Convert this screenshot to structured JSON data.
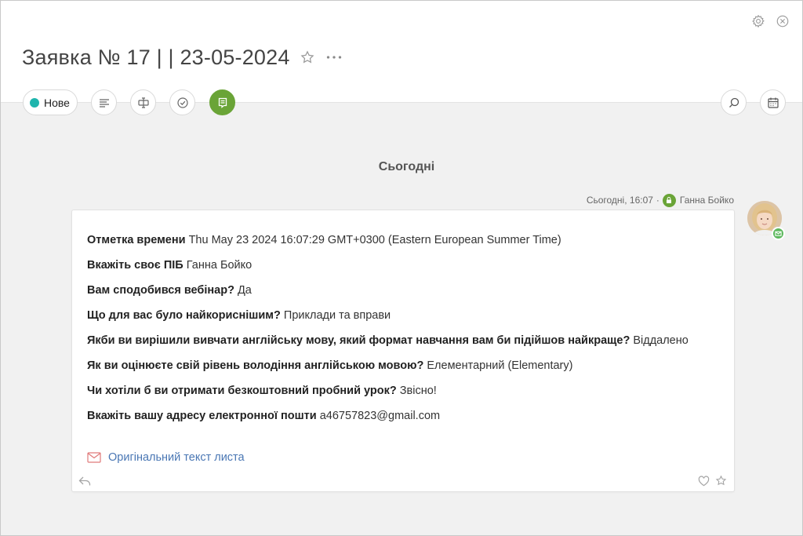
{
  "header": {
    "title": "Заявка № 17 | | 23-05-2024"
  },
  "toolbar": {
    "status_label": "Нове",
    "status_color": "#1fb5ad",
    "active_color": "#6aa437"
  },
  "icons": {
    "settings": "gear-icon",
    "close": "close-icon",
    "favorite": "star-icon",
    "more": "more-icon",
    "details": "list-icon",
    "fields": "text-field-icon",
    "tasks": "check-circle-icon",
    "feed": "chat-icon",
    "search": "search-icon",
    "calendar": "calendar-icon"
  },
  "feed": {
    "day_label": "Сьогодні",
    "message": {
      "time": "Сьогодні, 16:07",
      "author": "Ганна Бойко",
      "fields": [
        {
          "key": "Отметка времени",
          "value": "Thu May 23 2024 16:07:29 GMT+0300 (Eastern European Summer Time)"
        },
        {
          "key": "Вкажіть своє ПІБ",
          "value": "Ганна Бойко"
        },
        {
          "key": "Вам сподобився вебінар?",
          "value": "Да"
        },
        {
          "key": "Що для вас було найкориснішим?",
          "value": "Приклади та вправи"
        },
        {
          "key": "Якби ви вирішили вивчати англійську мову, який формат навчання вам би підійшов найкраще?",
          "value": "Віддалено"
        },
        {
          "key": "Як ви оцінюєте свій рівень володіння англійською мовою?",
          "value": "Елементарний (Elementary)"
        },
        {
          "key": "Чи хотіли б ви отримати безкоштовний пробний урок?",
          "value": "Звісно!"
        },
        {
          "key": "Вкажіть вашу адресу електронної пошти",
          "value": "a46757823@gmail.com"
        }
      ],
      "original_link": "Оригінальний текст листа"
    }
  }
}
